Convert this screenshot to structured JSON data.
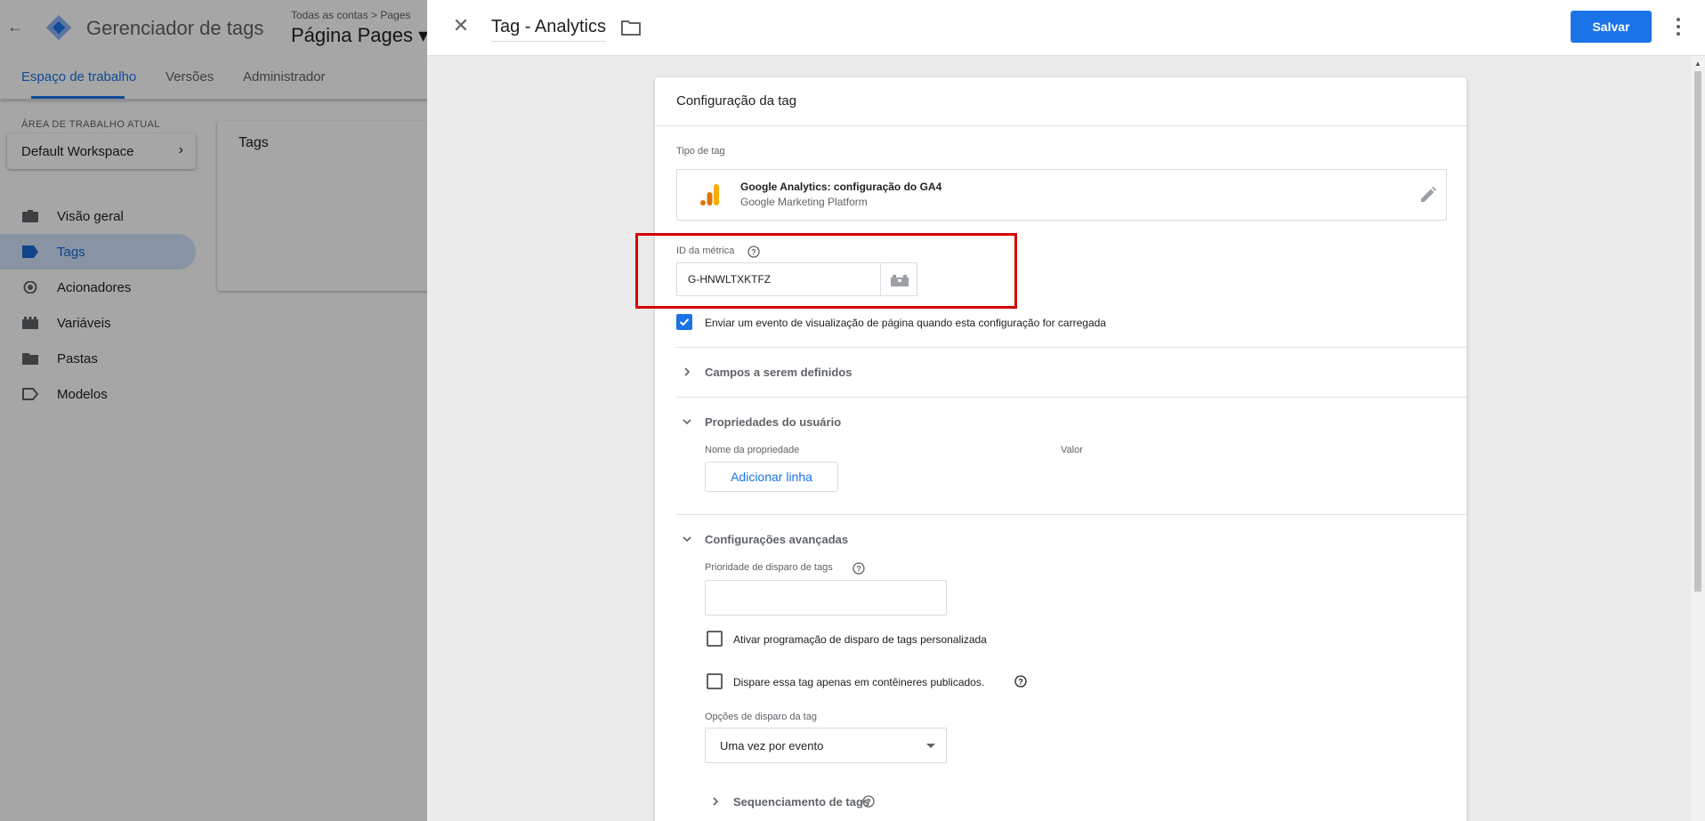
{
  "app": {
    "title": "Gerenciador de tags",
    "account_crumb": "Todas as contas > Pages",
    "container_name": "Página Pages ▾",
    "tabs": [
      {
        "label": "Espaço de trabalho"
      },
      {
        "label": "Versões"
      },
      {
        "label": "Administrador"
      }
    ],
    "workspace": {
      "label": "ÁREA DE TRABALHO ATUAL",
      "name": "Default Workspace"
    },
    "sidebar": [
      {
        "label": "Visão geral",
        "icon": "briefcase-icon"
      },
      {
        "label": "Tags",
        "icon": "tag-icon"
      },
      {
        "label": "Acionadores",
        "icon": "trigger-icon"
      },
      {
        "label": "Variáveis",
        "icon": "variables-icon"
      },
      {
        "label": "Pastas",
        "icon": "folder-icon"
      },
      {
        "label": "Modelos",
        "icon": "template-icon"
      }
    ],
    "tags_card_title": "Tags"
  },
  "panel": {
    "tag_name": "Tag - Analytics",
    "save_label": "Salvar",
    "card_title": "Configuração da tag",
    "tag_type_label": "Tipo de tag",
    "tag_type_name": "Google Analytics: configuração do GA4",
    "tag_type_provider": "Google Marketing Platform",
    "metric_id_label": "ID da métrica",
    "metric_id_value": "G-HNWLTXKTFZ",
    "send_pageview_label": "Enviar um evento de visualização de página quando esta configuração for carregada",
    "fields_to_set_label": "Campos a serem definidos",
    "user_properties_label": "Propriedades do usuário",
    "property_name_col": "Nome da propriedade",
    "value_col": "Valor",
    "add_row_label": "Adicionar linha",
    "advanced_label": "Configurações avançadas",
    "priority_label": "Prioridade de disparo de tags",
    "custom_schedule_label": "Ativar programação de disparo de tags personalizada",
    "published_only_label": "Dispare essa tag apenas em contêineres publicados.",
    "firing_options_label": "Opções de disparo da tag",
    "firing_option_value": "Uma vez por evento",
    "sequencing_label": "Sequenciamento de tags"
  },
  "colors": {
    "accent": "#1a73e8",
    "highlight": "#d50000",
    "ga_orange": "#f9ab00",
    "ga_dark_orange": "#e37400"
  }
}
